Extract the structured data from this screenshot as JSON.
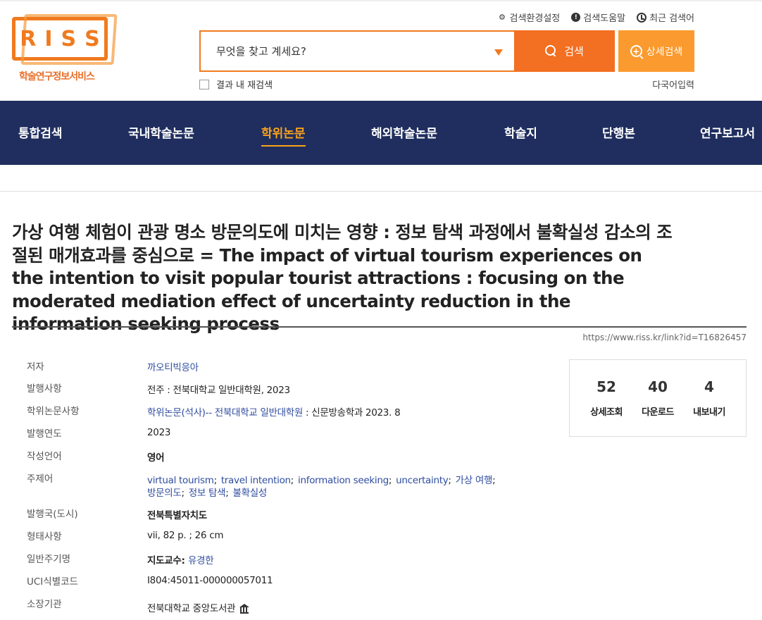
{
  "header": {
    "logo_letters": [
      "R",
      "I",
      "S",
      "S"
    ],
    "logo_subtitle": "학술연구정보서비스",
    "util": {
      "settings": "검색환경설정",
      "help": "검색도움말",
      "recent": "최근 검색어"
    },
    "search": {
      "placeholder": "무엇을 찾고 계세요?",
      "button": "검색",
      "advanced": "상세검색",
      "within_results": "결과 내 재검색",
      "multilang": "다국어입력"
    }
  },
  "nav": {
    "items": [
      "통합검색",
      "국내학술논문",
      "학위논문",
      "해외학술논문",
      "학술지",
      "단행본",
      "연구보고서"
    ],
    "active_index": 2,
    "active_color": "#f9a21c"
  },
  "document": {
    "title": "가상 여행 체험이 관광 명소 방문의도에 미치는 영향 : 정보 탐색 과정에서 불확실성 감소의 조절된 매개효과를 중심으로 = The impact of virtual tourism experiences on the intention to visit popular tourist attractions : focusing on the moderated mediation effect of uncertainty reduction in the information seeking process",
    "permalink": "https://www.riss.kr/link?id=T16826457",
    "meta": {
      "author_label": "저자",
      "author": "까오티빅응아",
      "publisher_label": "발행사항",
      "publisher": "전주 : 전북대학교 일반대학원, 2023",
      "degree_label": "학위논문사항",
      "degree_link": "학위논문(석사)-- 전북대학교 일반대학원",
      "degree_rest": " : 신문방송학과 2023. 8",
      "year_label": "발행연도",
      "year": "2023",
      "language_label": "작성언어",
      "language": "영어",
      "keywords_label": "주제어",
      "keywords_line1": [
        "virtual tourism",
        "travel intention",
        "information seeking",
        "uncertainty",
        "가상 여행"
      ],
      "keywords_line2": [
        "방문의도",
        "정보 탐색",
        "불확실성"
      ],
      "country_label": "발행국(도시)",
      "country": "전북특별자치도",
      "format_label": "형태사항",
      "format": "vii, 82 p. ; 26 cm",
      "note_label": "일반주기명",
      "note_prefix": "지도교수: ",
      "note_advisor": "유경한",
      "uci_label": "UCI식별코드",
      "uci": "I804:45011-000000057011",
      "holding_label": "소장기관",
      "holding": "전북대학교 중앙도서관"
    },
    "stats": [
      {
        "value": "52",
        "label": "상세조회"
      },
      {
        "value": "40",
        "label": "다운로드"
      },
      {
        "value": "4",
        "label": "내보내기"
      }
    ]
  }
}
